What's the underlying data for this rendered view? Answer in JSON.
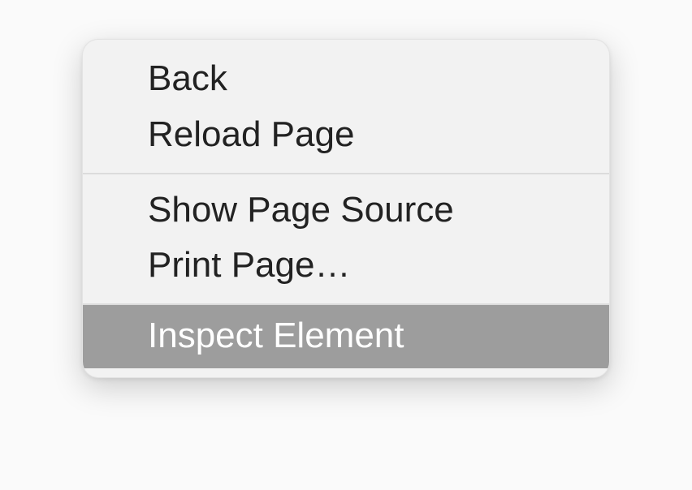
{
  "context_menu": {
    "items": [
      {
        "label": "Back",
        "highlighted": false
      },
      {
        "label": "Reload Page",
        "highlighted": false
      },
      {
        "separator": true
      },
      {
        "label": "Show Page Source",
        "highlighted": false
      },
      {
        "label": "Print Page…",
        "highlighted": false
      },
      {
        "separator": true
      },
      {
        "label": "Inspect Element",
        "highlighted": true
      }
    ]
  }
}
